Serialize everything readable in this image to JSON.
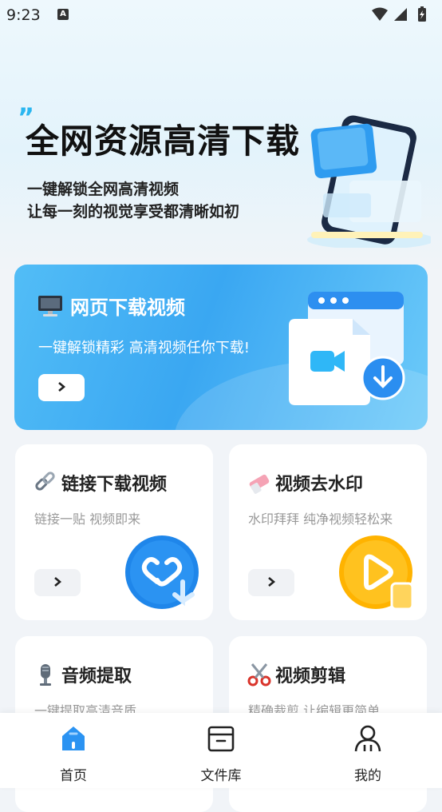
{
  "status_bar": {
    "time": "9:23",
    "notif_icon": "a-icon"
  },
  "hero": {
    "quote_mark": "”",
    "title": "全网资源高清下载",
    "subtitle_line1": "一键解锁全网高清视频",
    "subtitle_line2": "让每一刻的视觉享受都清晰如初"
  },
  "main_card": {
    "title": "网页下载视频",
    "subtitle": "一键解锁精彩 高清视频任你下载!",
    "button_icon": "chevron-right-icon"
  },
  "cards": [
    {
      "title": "链接下载视频",
      "subtitle": "链接一贴 视频即来",
      "icon": "link-icon",
      "has_button": true
    },
    {
      "title": "视频去水印",
      "subtitle": "水印拜拜 纯净视频轻松来",
      "icon": "eraser-icon",
      "has_button": true
    },
    {
      "title": "音频提取",
      "subtitle": "一键提取高清音质",
      "icon": "microphone-icon"
    },
    {
      "title": "视频剪辑",
      "subtitle": "精确裁剪 让编辑更简单",
      "icon": "scissors-icon"
    }
  ],
  "nav": [
    {
      "label": "首页",
      "icon": "home-icon",
      "active": true
    },
    {
      "label": "文件库",
      "icon": "archive-box-icon",
      "active": false
    },
    {
      "label": "我的",
      "icon": "user-icon",
      "active": false
    }
  ],
  "colors": {
    "accent": "#3aa7f2",
    "orange": "#ffb300",
    "text": "#222222",
    "muted": "#999999"
  }
}
